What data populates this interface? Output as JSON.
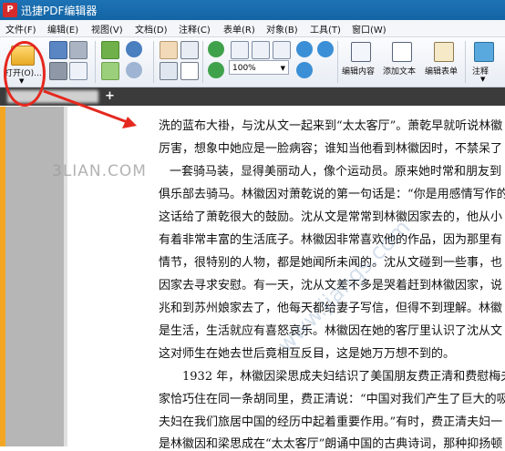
{
  "window": {
    "title": "迅捷PDF编辑器",
    "logo_text": "P"
  },
  "menu": [
    "文件(F)",
    "编辑(E)",
    "视图(V)",
    "文档(D)",
    "注释(C)",
    "表单(R)",
    "对象(B)",
    "工具(T)",
    "窗口(W)"
  ],
  "toolbar": {
    "open_label": "打开(O)...",
    "zoom_value": "100%",
    "edit_content_label": "编辑内容",
    "add_text_label": "添加文本",
    "edit_form_label": "编辑表单",
    "annotate_label": "注释"
  },
  "watermark_text": "3LIAN.COM",
  "diag_watermark_text": "www.jiangs.com",
  "document_lines": [
    "洗的蓝布大褂，与沈从文一起来到“太太客厅”。萧乾早就听说林徽",
    "厉害，想象中她应是一脸病容；谁知当他看到林徽因时，不禁呆了",
    "一套骑马装，显得美丽动人，像个运动员。原来她时常和朋友到",
    "俱乐部去骑马。林徽因对萧乾说的第一句话是：“你是用感情写作的",
    "这话给了萧乾很大的鼓励。沈从文是常常到林徽因家去的，他从小",
    "有着非常丰富的生活底子。林徽因非常喜欢他的作品，因为那里有",
    "情节，很特别的人物，都是她闻所未闻的。沈从文碰到一些事，也",
    "因家去寻求安慰。有一天，沈从文差不多是哭着赶到林徽因家，说",
    "兆和到苏州娘家去了，他每天都给妻子写信，但得不到理解。林徽",
    "是生活，生活就应有喜怒哀乐。林徽因在她的客厅里认识了沈从文",
    "这对师生在她去世后竟相互反目，这是她万万想不到的。",
    "1932 年，林徽因梁思成夫妇结识了美国朋友费正清和费慰梅夫",
    "家恰巧住在同一条胡同里，费正清说：“中国对我们产生了巨大的吸",
    "夫妇在我们旅居中国的经历中起着重要作用。”有时，费正清夫妇一",
    "是林徽因和梁思成在“太太客厅”朗诵中国的古典诗词，那种抑扬顿"
  ],
  "colors": {
    "titlebar": "#1464a4",
    "highlight_ring": "#e5281e"
  }
}
